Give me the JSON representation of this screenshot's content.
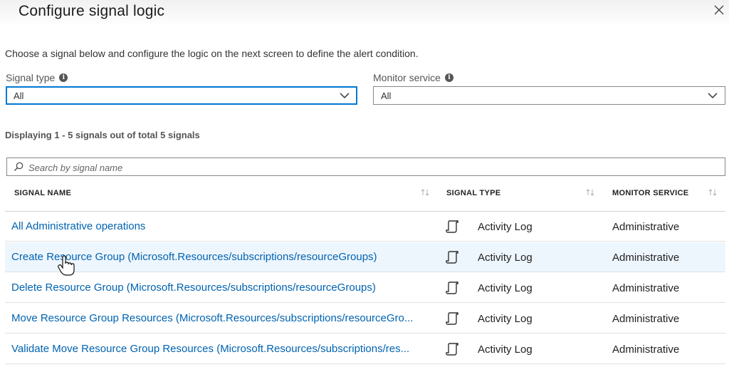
{
  "panel": {
    "title": "Configure signal logic",
    "intro": "Choose a signal below and configure the logic on the next screen to define the alert condition."
  },
  "filters": {
    "signal_type": {
      "label": "Signal type",
      "value": "All"
    },
    "monitor_service": {
      "label": "Monitor service",
      "value": "All"
    }
  },
  "count_text": "Displaying 1 - 5 signals out of total 5 signals",
  "search": {
    "placeholder": "Search by signal name"
  },
  "table": {
    "columns": [
      "SIGNAL NAME",
      "SIGNAL TYPE",
      "MONITOR SERVICE"
    ],
    "rows": [
      {
        "name": "All Administrative operations",
        "type": "Activity Log",
        "service": "Administrative"
      },
      {
        "name": "Create Resource Group (Microsoft.Resources/subscriptions/resourceGroups)",
        "type": "Activity Log",
        "service": "Administrative"
      },
      {
        "name": "Delete Resource Group (Microsoft.Resources/subscriptions/resourceGroups)",
        "type": "Activity Log",
        "service": "Administrative"
      },
      {
        "name": "Move Resource Group Resources (Microsoft.Resources/subscriptions/resourceGro...",
        "type": "Activity Log",
        "service": "Administrative"
      },
      {
        "name": "Validate Move Resource Group Resources (Microsoft.Resources/subscriptions/res...",
        "type": "Activity Log",
        "service": "Administrative"
      }
    ]
  },
  "colors": {
    "link": "#0063b1",
    "accent": "#0078d4",
    "row_hover": "#eef6fd"
  },
  "icons": {
    "close": "close-icon",
    "info": "info-icon",
    "dropdown": "chevron-down-icon",
    "search": "search-icon",
    "sort": "sort-icon",
    "activity_log": "activity-log-icon"
  }
}
